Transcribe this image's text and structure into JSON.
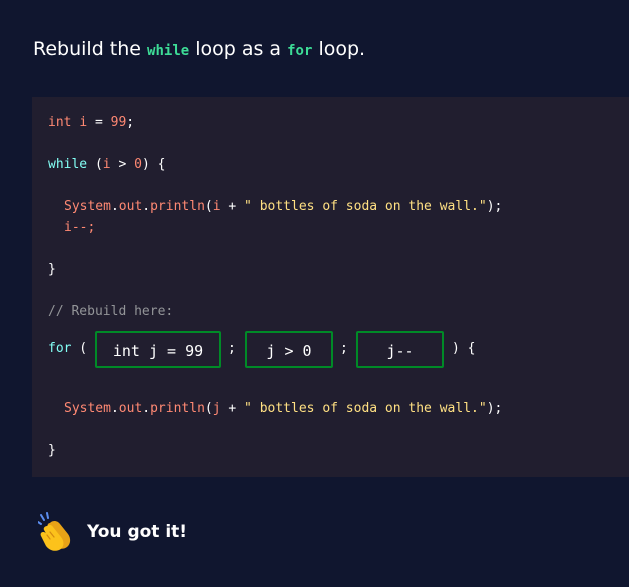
{
  "prompt": {
    "text_before": "Rebuild the ",
    "code1": "while",
    "text_middle": " loop as a ",
    "code2": "for",
    "text_after": " loop."
  },
  "code": {
    "line1": {
      "kw": "int",
      "var": "i",
      "eq": " = ",
      "num": "99",
      "semi": ";"
    },
    "line2": {
      "kw": "while",
      "open": " (",
      "var": "i",
      "op": " > ",
      "num": "0",
      "close": ") {"
    },
    "line3": {
      "obj": "System",
      "dot1": ".",
      "field": "out",
      "dot2": ".",
      "method": "println",
      "open": "(",
      "var": "i",
      "op": " + ",
      "str": "\" bottles of soda on the wall.\"",
      "close": ");"
    },
    "line4": {
      "text": "i--;"
    },
    "line5": {
      "text": "}"
    },
    "comment": "// Rebuild here:",
    "for_kw": "for",
    "for_open": " (",
    "sep1": ";",
    "sep2": ";",
    "for_close": ") {",
    "line_print2": {
      "obj": "System",
      "dot1": ".",
      "field": "out",
      "dot2": ".",
      "method": "println",
      "open": "(",
      "var": "j",
      "op": " + ",
      "str": "\" bottles of soda on the wall.\"",
      "close": ");"
    },
    "line_end": "}"
  },
  "blanks": {
    "init": "int j = 99",
    "condition": "j > 0",
    "update": "j--"
  },
  "feedback": {
    "icon": "clapping-hands-icon",
    "text": "You got it!"
  },
  "colors": {
    "background": "#10162f",
    "panel": "#211e2f",
    "accent": "#3ddc97",
    "blank_border": "#008a27"
  }
}
